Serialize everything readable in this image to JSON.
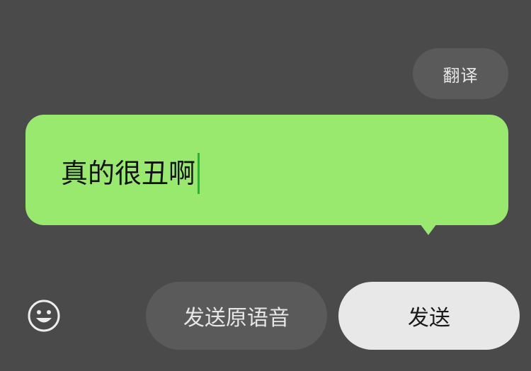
{
  "toolbar": {
    "translate_label": "翻译"
  },
  "bubble": {
    "text": "真的很丑啊"
  },
  "actions": {
    "send_original_label": "发送原语音",
    "send_label": "发送"
  },
  "icons": {
    "emoji": "emoji-icon"
  },
  "colors": {
    "background": "#4a4a4a",
    "bubble": "#98e96e",
    "caret": "#1fb83a",
    "send_button": "#e8e8e8",
    "secondary_button": "#5a5a5a"
  }
}
